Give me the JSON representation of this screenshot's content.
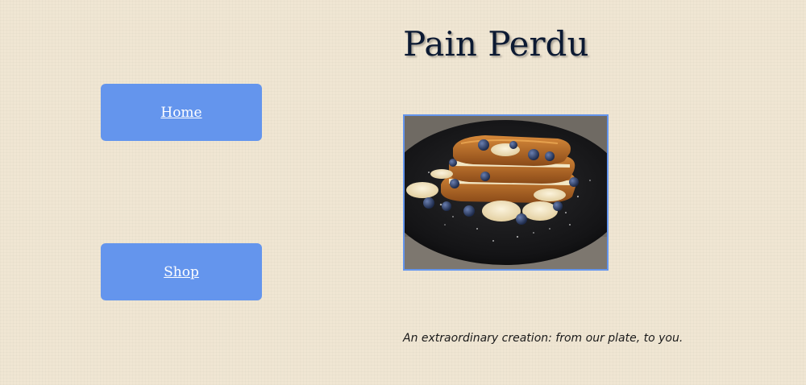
{
  "nav": {
    "home_label": "Home",
    "shop_label": "Shop"
  },
  "page": {
    "title": "Pain Perdu",
    "tagline": "An extraordinary creation: from our plate, to you."
  },
  "colors": {
    "background": "#f0e6d3",
    "button": "#6495ed",
    "button_text": "#ffffff",
    "title": "#0c1a33"
  },
  "image": {
    "subject": "french-toast-with-banana-and-blueberries"
  }
}
